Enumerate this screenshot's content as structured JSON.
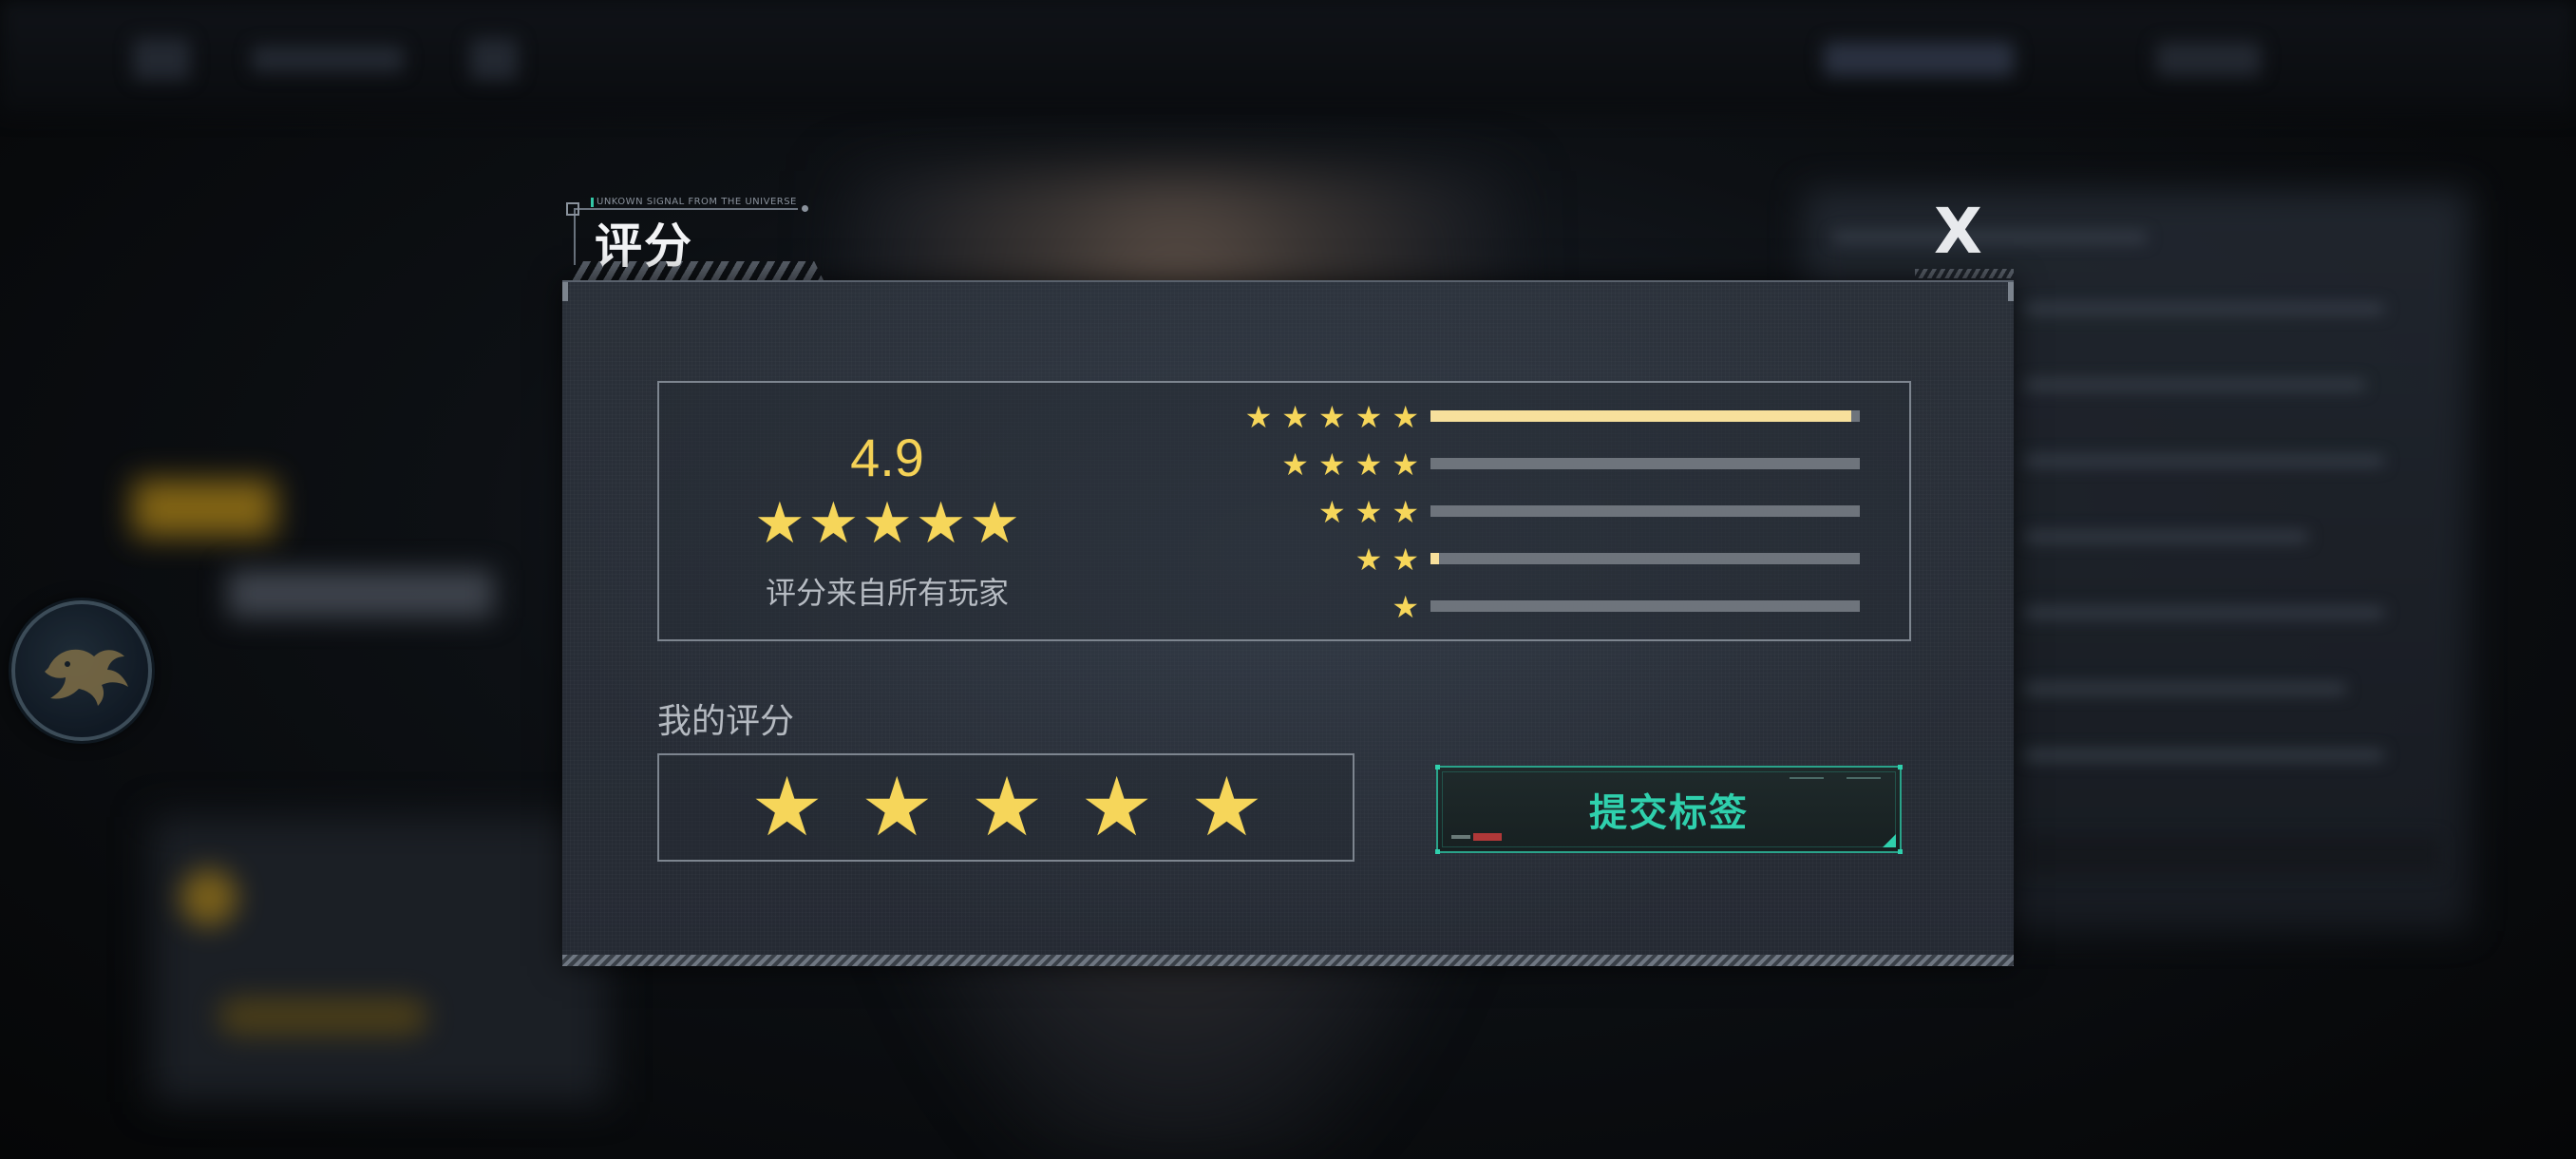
{
  "modal": {
    "title": "评分",
    "subtitle": "UNKOWN SIGNAL FROM THE UNIVERSE",
    "close_glyph": "X"
  },
  "summary": {
    "average": "4.9",
    "average_stars": [
      "★",
      "★",
      "★",
      "★",
      "★"
    ],
    "caption": "评分来自所有玩家",
    "distribution": [
      {
        "stars": 5,
        "fraction": 0.98
      },
      {
        "stars": 4,
        "fraction": 0.0
      },
      {
        "stars": 3,
        "fraction": 0.0
      },
      {
        "stars": 2,
        "fraction": 0.02
      },
      {
        "stars": 1,
        "fraction": 0.0
      }
    ]
  },
  "my_rating": {
    "label": "我的评分",
    "stars": [
      "★",
      "★",
      "★",
      "★",
      "★"
    ],
    "value": 5
  },
  "submit": {
    "label": "提交标签"
  },
  "colors": {
    "star": "#f6d65a",
    "bar_fill": "#f7e09c",
    "bar_track": "#6e747c",
    "accent_teal": "#2fd0ad"
  },
  "icons": {
    "star": "star-icon",
    "close": "close-icon",
    "avatar": "phoenix-emblem-icon"
  }
}
